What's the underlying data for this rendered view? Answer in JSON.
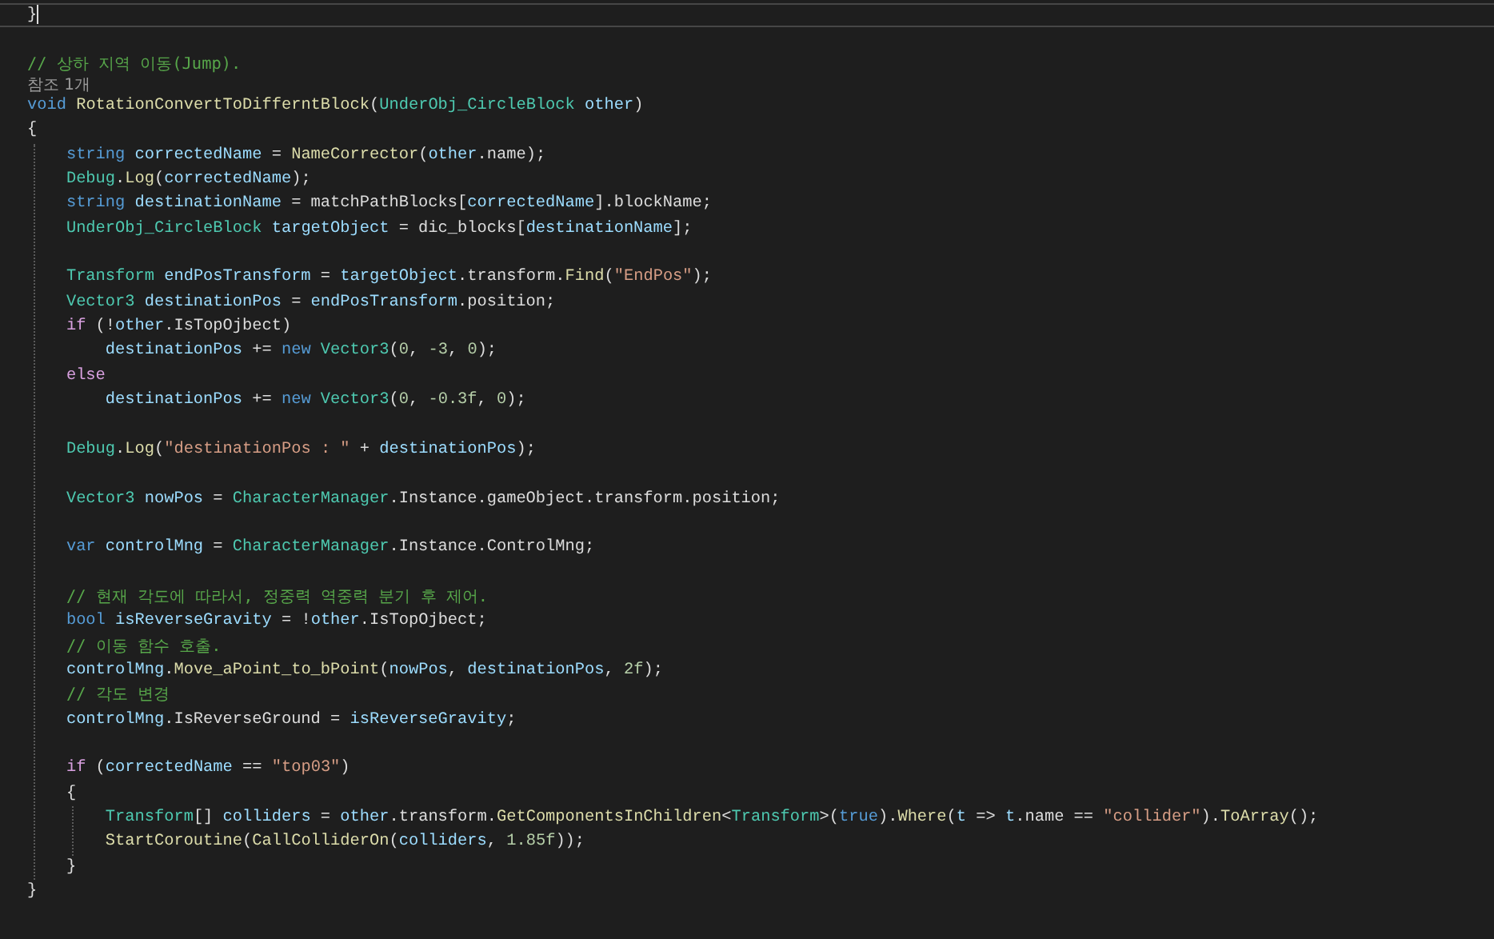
{
  "editor": {
    "lines": [
      {
        "kind": "code",
        "current": true,
        "tokens": [
          {
            "kind": "plain",
            "text": "}"
          }
        ]
      },
      {
        "kind": "blank"
      },
      {
        "kind": "comment",
        "text": "// 상하 지역 이동(Jump)."
      },
      {
        "kind": "codelens",
        "text": "참조 1개"
      },
      {
        "kind": "code",
        "tokens": [
          {
            "kind": "kw",
            "text": "void"
          },
          {
            "kind": "method",
            "text": " RotationConvertToDifferntBlock"
          },
          {
            "kind": "plain",
            "text": "("
          },
          {
            "kind": "type",
            "text": "UnderObj_CircleBlock"
          },
          {
            "kind": "local",
            "text": " other"
          },
          {
            "kind": "plain",
            "text": ")"
          }
        ]
      },
      {
        "kind": "code",
        "tokens": [
          {
            "kind": "plain",
            "text": "{"
          }
        ]
      },
      {
        "kind": "block",
        "children": [
          {
            "kind": "code",
            "tokens": [
              {
                "kind": "kw",
                "text": "string"
              },
              {
                "kind": "local",
                "text": " correctedName"
              },
              {
                "kind": "plain",
                "text": " = "
              },
              {
                "kind": "method",
                "text": "NameCorrector"
              },
              {
                "kind": "plain",
                "text": "("
              },
              {
                "kind": "local",
                "text": "other"
              },
              {
                "kind": "plain",
                "text": ".name);"
              }
            ]
          },
          {
            "kind": "code",
            "tokens": [
              {
                "kind": "type",
                "text": "Debug"
              },
              {
                "kind": "plain",
                "text": "."
              },
              {
                "kind": "method",
                "text": "Log"
              },
              {
                "kind": "plain",
                "text": "("
              },
              {
                "kind": "local",
                "text": "correctedName"
              },
              {
                "kind": "plain",
                "text": ");"
              }
            ]
          },
          {
            "kind": "code",
            "tokens": [
              {
                "kind": "kw",
                "text": "string"
              },
              {
                "kind": "local",
                "text": " destinationName"
              },
              {
                "kind": "plain",
                "text": " = matchPathBlocks["
              },
              {
                "kind": "local",
                "text": "correctedName"
              },
              {
                "kind": "plain",
                "text": "].blockName;"
              }
            ]
          },
          {
            "kind": "code",
            "tokens": [
              {
                "kind": "type",
                "text": "UnderObj_CircleBlock"
              },
              {
                "kind": "local",
                "text": " targetObject"
              },
              {
                "kind": "plain",
                "text": " = dic_blocks["
              },
              {
                "kind": "local",
                "text": "destinationName"
              },
              {
                "kind": "plain",
                "text": "];"
              }
            ]
          },
          {
            "kind": "blank"
          },
          {
            "kind": "code",
            "tokens": [
              {
                "kind": "type",
                "text": "Transform"
              },
              {
                "kind": "local",
                "text": " endPosTransform"
              },
              {
                "kind": "plain",
                "text": " = "
              },
              {
                "kind": "local",
                "text": "targetObject"
              },
              {
                "kind": "plain",
                "text": ".transform."
              },
              {
                "kind": "method",
                "text": "Find"
              },
              {
                "kind": "plain",
                "text": "("
              },
              {
                "kind": "str",
                "text": "\"EndPos\""
              },
              {
                "kind": "plain",
                "text": ");"
              }
            ]
          },
          {
            "kind": "code",
            "tokens": [
              {
                "kind": "type",
                "text": "Vector3"
              },
              {
                "kind": "local",
                "text": " destinationPos"
              },
              {
                "kind": "plain",
                "text": " = "
              },
              {
                "kind": "local",
                "text": "endPosTransform"
              },
              {
                "kind": "plain",
                "text": ".position;"
              }
            ]
          },
          {
            "kind": "code",
            "tokens": [
              {
                "kind": "ctrl",
                "text": "if"
              },
              {
                "kind": "plain",
                "text": " (!"
              },
              {
                "kind": "local",
                "text": "other"
              },
              {
                "kind": "plain",
                "text": ".IsTopOjbect)"
              }
            ]
          },
          {
            "kind": "code",
            "tokens": [
              {
                "kind": "local",
                "text": "    destinationPos"
              },
              {
                "kind": "plain",
                "text": " += "
              },
              {
                "kind": "kw",
                "text": "new"
              },
              {
                "kind": "type",
                "text": " Vector3"
              },
              {
                "kind": "plain",
                "text": "("
              },
              {
                "kind": "num",
                "text": "0"
              },
              {
                "kind": "plain",
                "text": ", "
              },
              {
                "kind": "num",
                "text": "-3"
              },
              {
                "kind": "plain",
                "text": ", "
              },
              {
                "kind": "num",
                "text": "0"
              },
              {
                "kind": "plain",
                "text": ");"
              }
            ]
          },
          {
            "kind": "code",
            "tokens": [
              {
                "kind": "ctrl",
                "text": "else"
              }
            ]
          },
          {
            "kind": "code",
            "tokens": [
              {
                "kind": "local",
                "text": "    destinationPos"
              },
              {
                "kind": "plain",
                "text": " += "
              },
              {
                "kind": "kw",
                "text": "new"
              },
              {
                "kind": "type",
                "text": " Vector3"
              },
              {
                "kind": "plain",
                "text": "("
              },
              {
                "kind": "num",
                "text": "0"
              },
              {
                "kind": "plain",
                "text": ", "
              },
              {
                "kind": "num",
                "text": "-0.3f"
              },
              {
                "kind": "plain",
                "text": ", "
              },
              {
                "kind": "num",
                "text": "0"
              },
              {
                "kind": "plain",
                "text": ");"
              }
            ]
          },
          {
            "kind": "blank"
          },
          {
            "kind": "code",
            "tokens": [
              {
                "kind": "type",
                "text": "Debug"
              },
              {
                "kind": "plain",
                "text": "."
              },
              {
                "kind": "method",
                "text": "Log"
              },
              {
                "kind": "plain",
                "text": "("
              },
              {
                "kind": "str",
                "text": "\"destinationPos : \""
              },
              {
                "kind": "plain",
                "text": " + "
              },
              {
                "kind": "local",
                "text": "destinationPos"
              },
              {
                "kind": "plain",
                "text": ");"
              }
            ]
          },
          {
            "kind": "blank"
          },
          {
            "kind": "code",
            "tokens": [
              {
                "kind": "type",
                "text": "Vector3"
              },
              {
                "kind": "local",
                "text": " nowPos"
              },
              {
                "kind": "plain",
                "text": " = "
              },
              {
                "kind": "type",
                "text": "CharacterManager"
              },
              {
                "kind": "plain",
                "text": ".Instance.gameObject.transform.position;"
              }
            ]
          },
          {
            "kind": "blank"
          },
          {
            "kind": "code",
            "tokens": [
              {
                "kind": "kw",
                "text": "var"
              },
              {
                "kind": "local",
                "text": " controlMng"
              },
              {
                "kind": "plain",
                "text": " = "
              },
              {
                "kind": "type",
                "text": "CharacterManager"
              },
              {
                "kind": "plain",
                "text": ".Instance.ControlMng;"
              }
            ]
          },
          {
            "kind": "blank"
          },
          {
            "kind": "comment",
            "text": "// 현재 각도에 따라서, 정중력 역중력 분기 후 제어."
          },
          {
            "kind": "code",
            "tokens": [
              {
                "kind": "kw",
                "text": "bool"
              },
              {
                "kind": "local",
                "text": " isReverseGravity"
              },
              {
                "kind": "plain",
                "text": " = !"
              },
              {
                "kind": "local",
                "text": "other"
              },
              {
                "kind": "plain",
                "text": ".IsTopOjbect;"
              }
            ]
          },
          {
            "kind": "comment",
            "text": "// 이동 함수 호출."
          },
          {
            "kind": "code",
            "tokens": [
              {
                "kind": "local",
                "text": "controlMng"
              },
              {
                "kind": "plain",
                "text": "."
              },
              {
                "kind": "method",
                "text": "Move_aPoint_to_bPoint"
              },
              {
                "kind": "plain",
                "text": "("
              },
              {
                "kind": "local",
                "text": "nowPos"
              },
              {
                "kind": "plain",
                "text": ", "
              },
              {
                "kind": "local",
                "text": "destinationPos"
              },
              {
                "kind": "plain",
                "text": ", "
              },
              {
                "kind": "num",
                "text": "2f"
              },
              {
                "kind": "plain",
                "text": ");"
              }
            ]
          },
          {
            "kind": "comment",
            "text": "// 각도 변경"
          },
          {
            "kind": "code",
            "tokens": [
              {
                "kind": "local",
                "text": "controlMng"
              },
              {
                "kind": "plain",
                "text": ".IsReverseGround = "
              },
              {
                "kind": "local",
                "text": "isReverseGravity"
              },
              {
                "kind": "plain",
                "text": ";"
              }
            ]
          },
          {
            "kind": "blank"
          },
          {
            "kind": "code",
            "tokens": [
              {
                "kind": "ctrl",
                "text": "if"
              },
              {
                "kind": "plain",
                "text": " ("
              },
              {
                "kind": "local",
                "text": "correctedName"
              },
              {
                "kind": "plain",
                "text": " == "
              },
              {
                "kind": "str",
                "text": "\"top03\""
              },
              {
                "kind": "plain",
                "text": ")"
              }
            ]
          },
          {
            "kind": "code",
            "tokens": [
              {
                "kind": "plain",
                "text": "{"
              }
            ]
          },
          {
            "kind": "block",
            "children": [
              {
                "kind": "code",
                "tokens": [
                  {
                    "kind": "type",
                    "text": "Transform"
                  },
                  {
                    "kind": "plain",
                    "text": "[] "
                  },
                  {
                    "kind": "local",
                    "text": "colliders"
                  },
                  {
                    "kind": "plain",
                    "text": " = "
                  },
                  {
                    "kind": "local",
                    "text": "other"
                  },
                  {
                    "kind": "plain",
                    "text": ".transform."
                  },
                  {
                    "kind": "method",
                    "text": "GetComponentsInChildren"
                  },
                  {
                    "kind": "plain",
                    "text": "<"
                  },
                  {
                    "kind": "type",
                    "text": "Transform"
                  },
                  {
                    "kind": "plain",
                    "text": ">("
                  },
                  {
                    "kind": "kw",
                    "text": "true"
                  },
                  {
                    "kind": "plain",
                    "text": ")."
                  },
                  {
                    "kind": "method",
                    "text": "Where"
                  },
                  {
                    "kind": "plain",
                    "text": "("
                  },
                  {
                    "kind": "local",
                    "text": "t"
                  },
                  {
                    "kind": "plain",
                    "text": " => "
                  },
                  {
                    "kind": "local",
                    "text": "t"
                  },
                  {
                    "kind": "plain",
                    "text": ".name == "
                  },
                  {
                    "kind": "str",
                    "text": "\"collider\""
                  },
                  {
                    "kind": "plain",
                    "text": ")."
                  },
                  {
                    "kind": "method",
                    "text": "ToArray"
                  },
                  {
                    "kind": "plain",
                    "text": "();"
                  }
                ]
              },
              {
                "kind": "code",
                "tokens": [
                  {
                    "kind": "method",
                    "text": "StartCoroutine"
                  },
                  {
                    "kind": "plain",
                    "text": "("
                  },
                  {
                    "kind": "method",
                    "text": "CallColliderOn"
                  },
                  {
                    "kind": "plain",
                    "text": "("
                  },
                  {
                    "kind": "local",
                    "text": "colliders"
                  },
                  {
                    "kind": "plain",
                    "text": ", "
                  },
                  {
                    "kind": "num",
                    "text": "1.85f"
                  },
                  {
                    "kind": "plain",
                    "text": "));"
                  }
                ]
              }
            ]
          },
          {
            "kind": "code",
            "tokens": [
              {
                "kind": "plain",
                "text": "}"
              }
            ]
          }
        ]
      },
      {
        "kind": "code",
        "tokens": [
          {
            "kind": "plain",
            "text": "}"
          }
        ]
      }
    ]
  }
}
